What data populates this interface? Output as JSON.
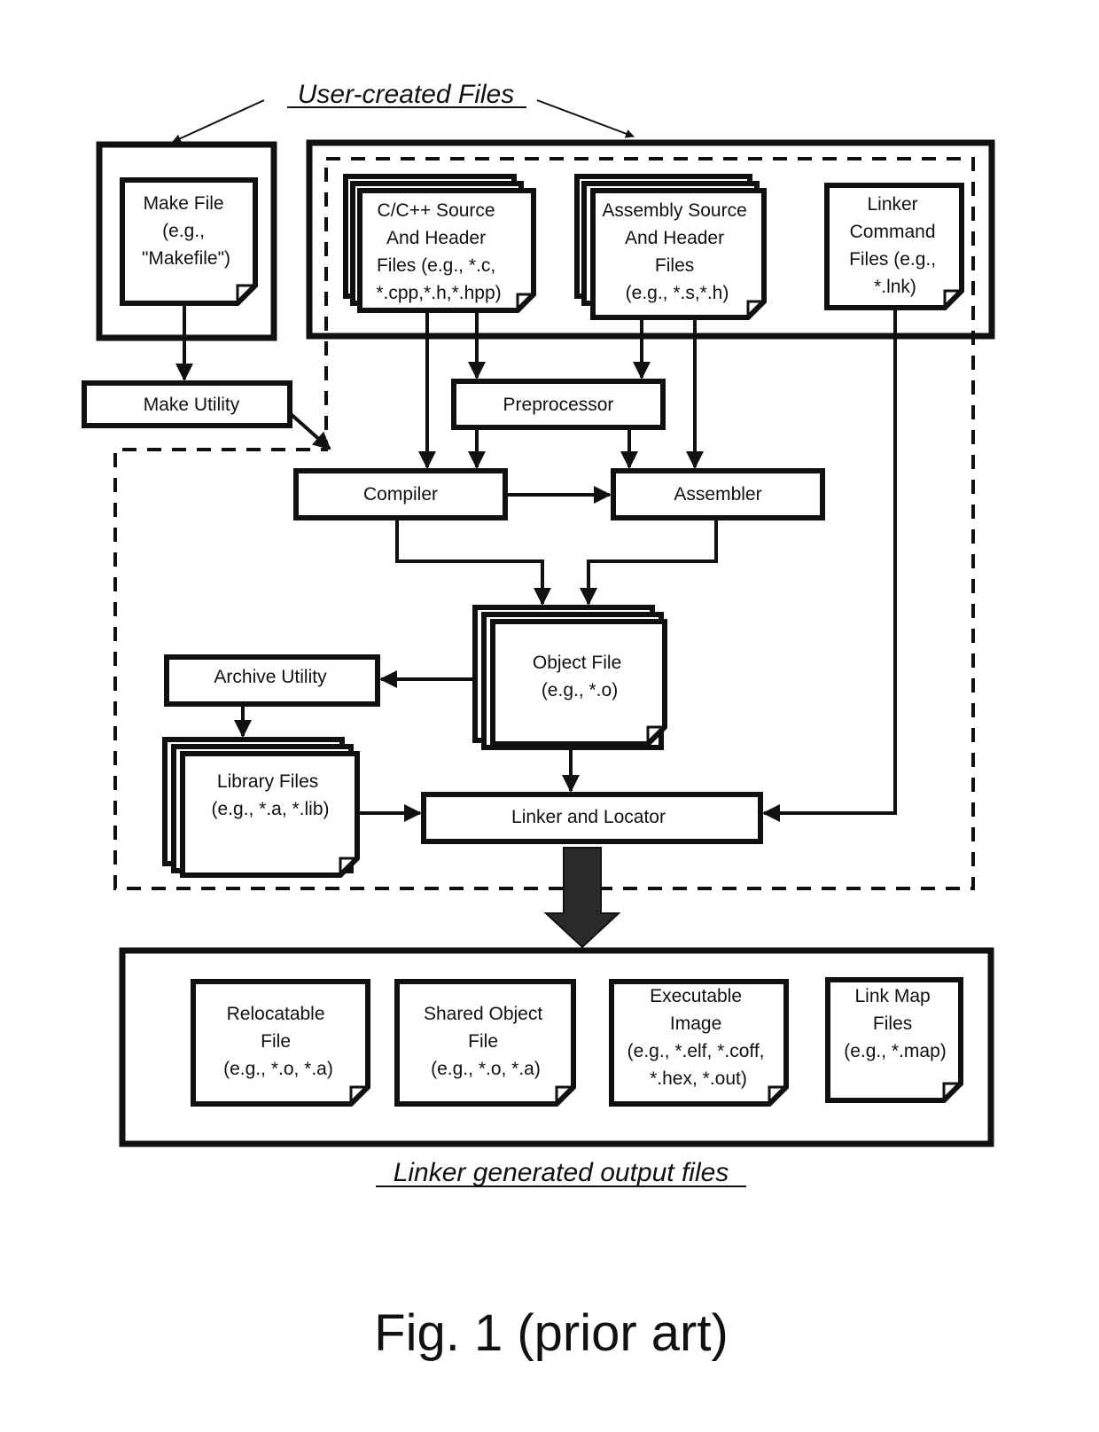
{
  "figure": {
    "caption": "Fig. 1 (prior art)",
    "user_files_header": "User-created Files",
    "output_files_header": "Linker generated output files"
  },
  "inputs": {
    "make_file": [
      "Make File",
      "(e.g.,",
      "\"Makefile\")"
    ],
    "c_source": [
      "C/C++ Source",
      "And Header",
      "Files (e.g., *.c,",
      "*.cpp,*.h,*.hpp)"
    ],
    "asm_source": [
      "Assembly Source",
      "And Header",
      "Files",
      "(e.g., *.s,*.h)"
    ],
    "linker_cmd": [
      "Linker",
      "Command",
      "Files (e.g.,",
      "*.lnk)"
    ]
  },
  "tools": {
    "make_utility": "Make Utility",
    "preprocessor": "Preprocessor",
    "compiler": "Compiler",
    "assembler": "Assembler",
    "archive_utility": "Archive Utility",
    "linker": "Linker and Locator"
  },
  "intermediate": {
    "object_file": [
      "Object File",
      "(e.g., *.o)"
    ],
    "library_files": [
      "Library Files",
      "(e.g., *.a, *.lib)"
    ]
  },
  "outputs": [
    {
      "id": "relocatable",
      "lines": [
        "Relocatable",
        "File",
        "(e.g., *.o, *.a)"
      ]
    },
    {
      "id": "shared-object",
      "lines": [
        "Shared Object",
        "File",
        "(e.g., *.o, *.a)"
      ]
    },
    {
      "id": "executable",
      "lines": [
        "Executable",
        "Image",
        "(e.g., *.elf, *.coff,",
        "*.hex, *.out)"
      ]
    },
    {
      "id": "link-map",
      "lines": [
        "Link Map",
        "Files",
        "(e.g., *.map)"
      ]
    }
  ]
}
